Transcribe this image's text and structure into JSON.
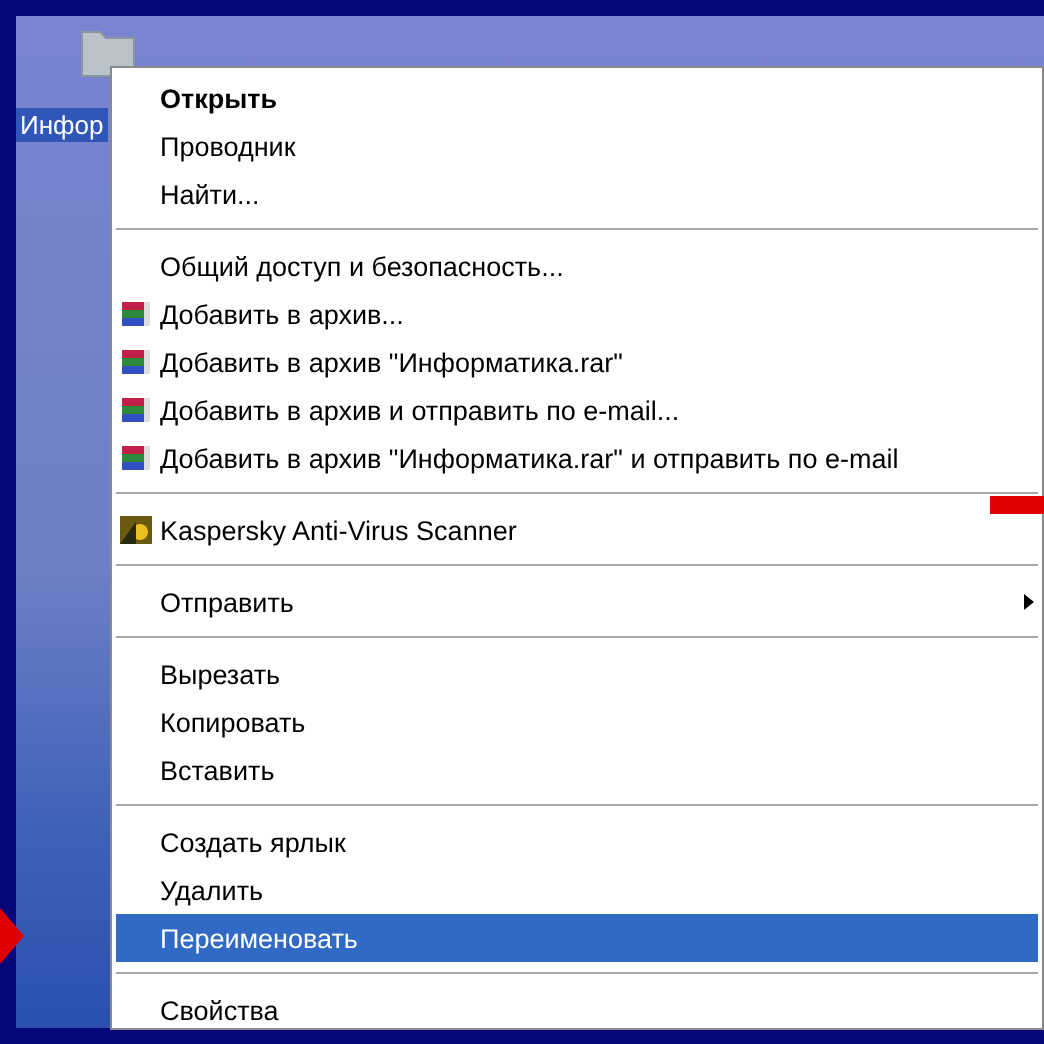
{
  "desktop_icon": {
    "label": "Инфор",
    "selected": true
  },
  "context_menu": {
    "groups": [
      [
        {
          "label": "Открыть",
          "default": true,
          "selected": false
        },
        {
          "label": "Проводник",
          "default": false,
          "selected": false
        },
        {
          "label": "Найти...",
          "default": false,
          "selected": false
        }
      ],
      [
        {
          "label": "Общий доступ и безопасность...",
          "default": false,
          "selected": false
        },
        {
          "label": "Добавить в архив...",
          "kind": "archive",
          "default": false,
          "selected": false
        },
        {
          "label": "Добавить в архив \"Информатика.rar\"",
          "kind": "archive",
          "default": false,
          "selected": false
        },
        {
          "label": "Добавить в архив и отправить по e-mail...",
          "kind": "archive",
          "default": false,
          "selected": false
        },
        {
          "label": "Добавить в архив \"Информатика.rar\" и отправить по e-mail",
          "kind": "archive",
          "default": false,
          "selected": false
        }
      ],
      [
        {
          "label": "Kaspersky Anti-Virus Scanner",
          "kind": "antivirus",
          "default": false,
          "selected": false
        }
      ],
      [
        {
          "label": "Отправить",
          "submenu": true,
          "default": false,
          "selected": false
        }
      ],
      [
        {
          "label": "Вырезать",
          "default": false,
          "selected": false
        },
        {
          "label": "Копировать",
          "default": false,
          "selected": false
        },
        {
          "label": "Вставить",
          "default": false,
          "selected": false
        }
      ],
      [
        {
          "label": "Создать ярлык",
          "default": false,
          "selected": false
        },
        {
          "label": "Удалить",
          "default": false,
          "selected": false
        },
        {
          "label": "Переименовать",
          "default": false,
          "selected": true
        }
      ],
      [
        {
          "label": "Свойства",
          "default": false,
          "selected": false
        }
      ]
    ]
  }
}
